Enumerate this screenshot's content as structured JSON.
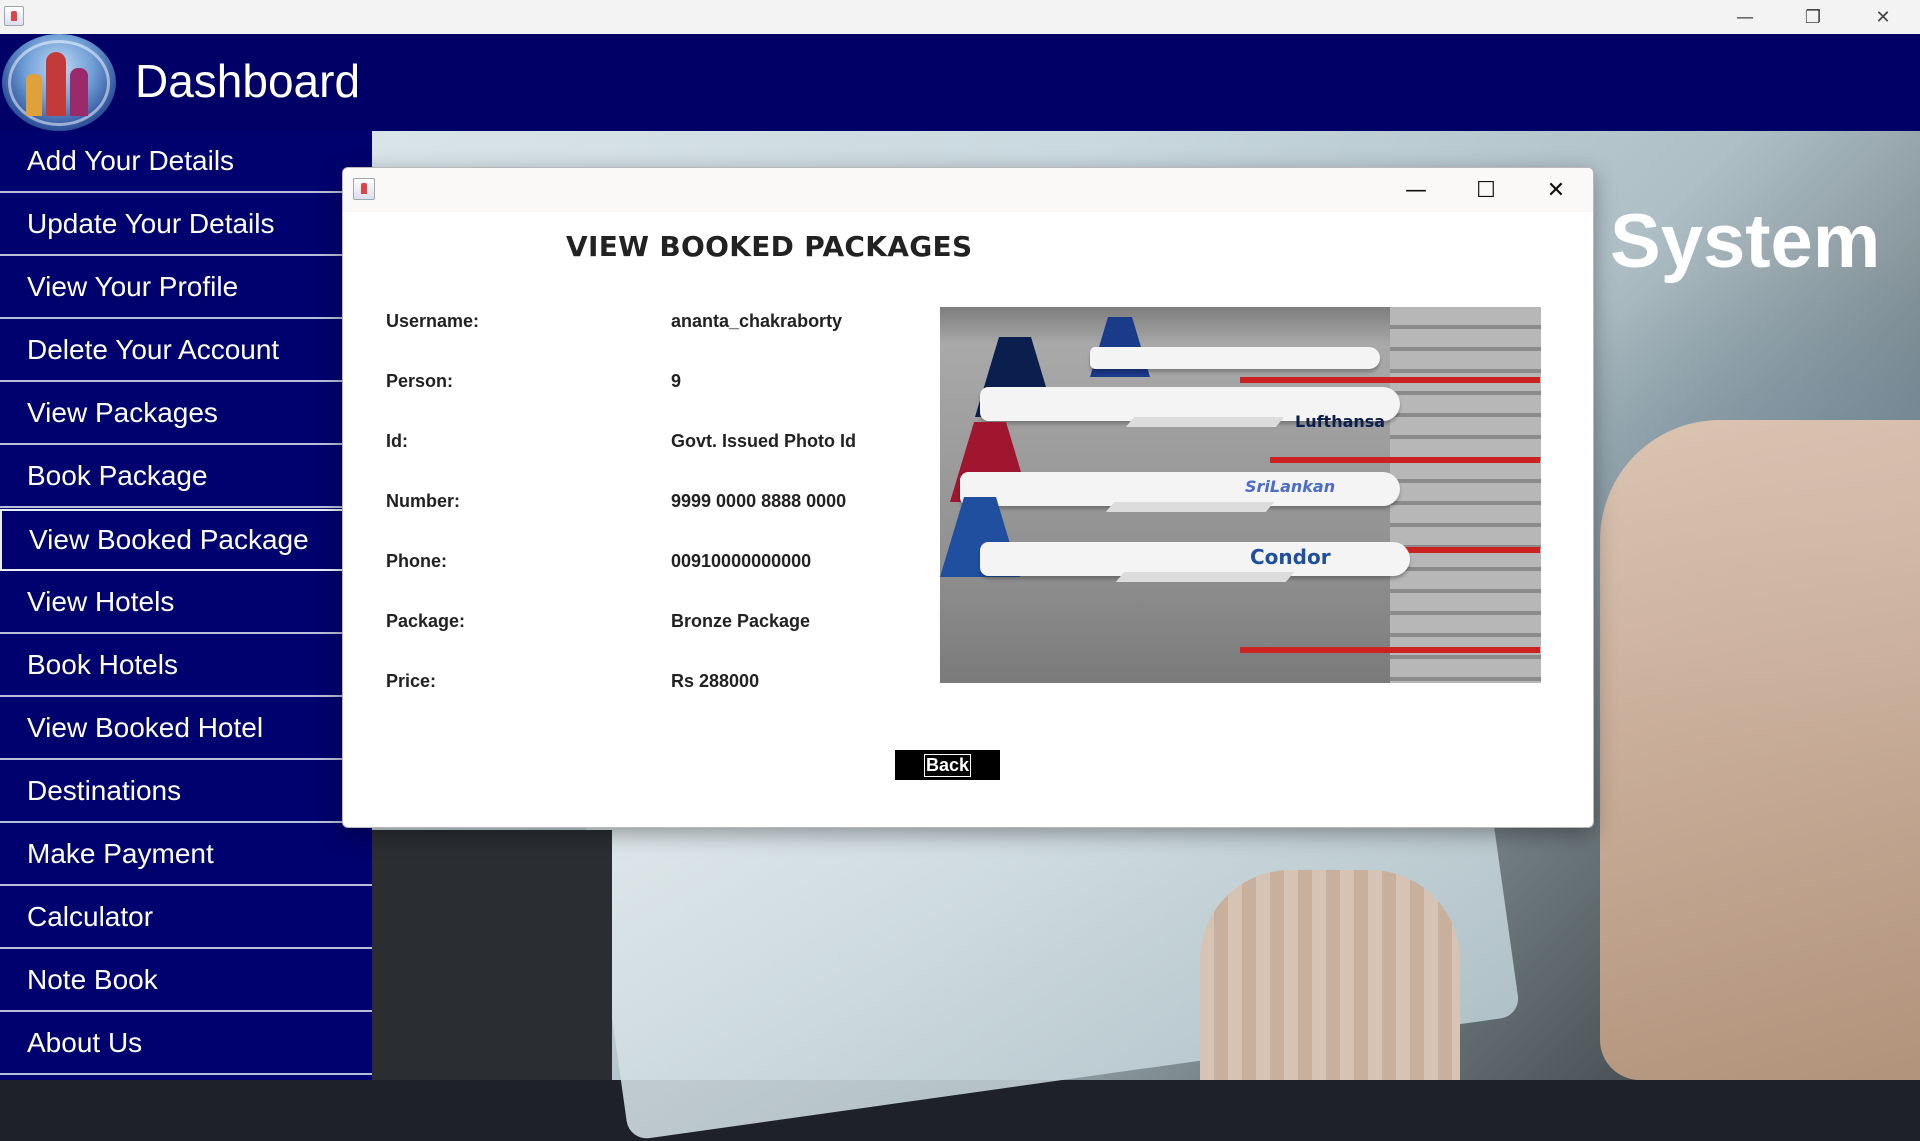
{
  "header": {
    "title": "Dashboard"
  },
  "background": {
    "overlay_text": "System"
  },
  "sidebar": {
    "items": [
      {
        "label": "Add Your Details"
      },
      {
        "label": "Update Your Details"
      },
      {
        "label": "View Your Profile"
      },
      {
        "label": "Delete Your Account"
      },
      {
        "label": "View Packages"
      },
      {
        "label": "Book Package"
      },
      {
        "label": "View Booked Package",
        "active": true
      },
      {
        "label": "View Hotels"
      },
      {
        "label": "Book Hotels"
      },
      {
        "label": "View Booked Hotel"
      },
      {
        "label": "Destinations"
      },
      {
        "label": "Make Payment"
      },
      {
        "label": "Calculator"
      },
      {
        "label": "Note Book"
      },
      {
        "label": "About Us"
      }
    ]
  },
  "dialog": {
    "heading": "VIEW BOOKED PACKAGES",
    "fields": [
      {
        "label": "Username:",
        "value": "ananta_chakraborty"
      },
      {
        "label": "Person:",
        "value": "9"
      },
      {
        "label": "Id:",
        "value": "Govt. Issued Photo Id"
      },
      {
        "label": "Number:",
        "value": "9999 0000 8888 0000"
      },
      {
        "label": "Phone:",
        "value": "00910000000000"
      },
      {
        "label": "Package:",
        "value": "Bronze Package"
      },
      {
        "label": "Price:",
        "value": "Rs 288000"
      }
    ],
    "photo_airlines": [
      "Lufthansa",
      "SriLankan",
      "Condor"
    ],
    "back_label": "Back"
  },
  "colors": {
    "header_bg": "#000066",
    "sidebar_bg": "#00006e",
    "button_bg": "#000000"
  }
}
